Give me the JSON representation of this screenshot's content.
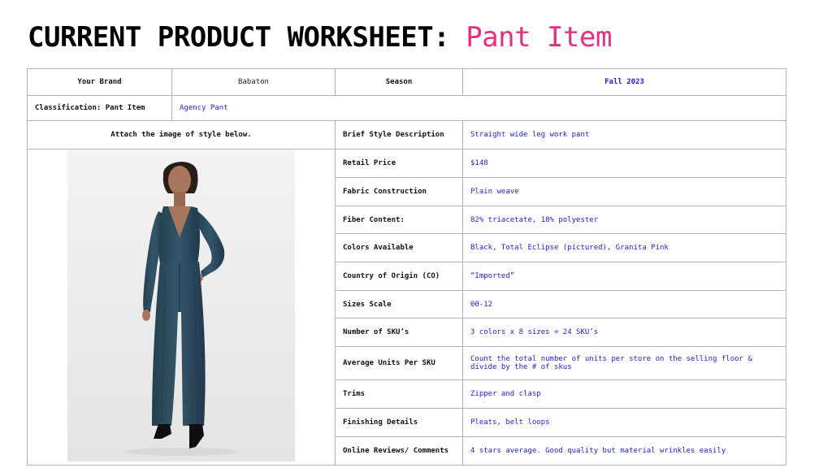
{
  "title": {
    "lead": "CURRENT PRODUCT WORKSHEET: ",
    "accent": "Pant Item"
  },
  "colors": {
    "accent": "#e0307e",
    "value_text": "#1f1fc8",
    "border": "#b3b3b3",
    "garment": "#2f4e62"
  },
  "header_row": {
    "brand_label": "Your Brand",
    "brand_value": "Babaton",
    "season_label": "Season",
    "season_value": "Fall 2023"
  },
  "classification": {
    "label": "Classification: Pant Item",
    "value": "Agency Pant"
  },
  "image_instruction": "Attach the image of style below.",
  "attributes": [
    {
      "label": "Brief Style Description",
      "value": "Straight wide leg work pant"
    },
    {
      "label": "Retail Price",
      "value": "$148"
    },
    {
      "label": "Fabric Construction",
      "value": "Plain weave"
    },
    {
      "label": "Fiber Content:",
      "value": "82% triacetate, 18% polyester"
    },
    {
      "label": "Colors Available",
      "value": "Black, Total Eclipse (pictured), Granita Pink"
    },
    {
      "label": "Country of Origin (CO)",
      "value": "“Imported”"
    },
    {
      "label": "Sizes Scale",
      "value": "00-12"
    },
    {
      "label": "Number of SKU’s",
      "value": "3 colors x 8 sizes = 24 SKU’s"
    },
    {
      "label": "Average Units Per SKU",
      "value": "Count the total number of units per store on the selling floor & divide by the # of skus"
    },
    {
      "label": "Trims",
      "value": "Zipper and clasp"
    },
    {
      "label": "Finishing Details",
      "value": "Pleats, belt loops"
    },
    {
      "label": "Online Reviews/ Comments",
      "value": "4 stars average. Good quality but material wrinkles easily"
    }
  ]
}
